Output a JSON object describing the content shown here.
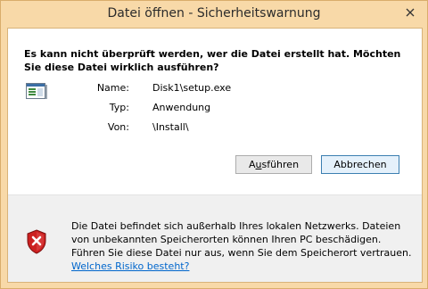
{
  "window": {
    "title": "Datei öffnen - Sicherheitswarnung",
    "close_glyph": "✕"
  },
  "dialog": {
    "heading": "Es kann nicht überprüft werden, wer die Datei erstellt hat. Möchten Sie diese Datei wirklich ausführen?",
    "file_icon": "application-window-icon",
    "properties": [
      {
        "label": "Name:",
        "value": "Disk1\\setup.exe"
      },
      {
        "label": "Typ:",
        "value": "Anwendung"
      },
      {
        "label": "Von:",
        "value": "\\Install\\"
      }
    ],
    "buttons": {
      "run": {
        "label_prefix": "A",
        "label_accel": "u",
        "label_suffix": "sführen"
      },
      "cancel": {
        "label": "Abbrechen"
      }
    }
  },
  "warning": {
    "icon": "security-shield-icon",
    "text": "Die Datei befindet sich außerhalb Ihres lokalen Netzwerks. Dateien von unbekannten Speicherorten können Ihren PC beschädigen. Führen Sie diese Datei nur aus, wenn Sie dem Speicherort vertrauen.",
    "link": "Welches Risiko besteht?"
  },
  "colors": {
    "frame": "#f8d9a8",
    "link": "#0066cc",
    "shield_red": "#cc2020"
  }
}
